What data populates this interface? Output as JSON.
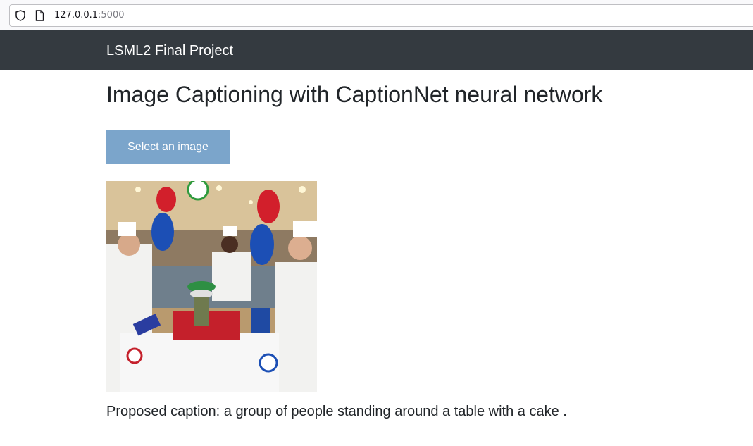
{
  "browser": {
    "url_host": "127.0.0.1",
    "url_port": ":5000",
    "icons": [
      "shield-icon",
      "page-icon"
    ]
  },
  "navbar": {
    "brand": "LSML2 Final Project",
    "background": "#343a40"
  },
  "main": {
    "title": "Image Captioning with CaptionNet neural network",
    "select_button_label": "Select an image",
    "button_color": "#7ba5cb",
    "caption_label": "Proposed caption:",
    "caption_text": "a group of people standing around a table with a cake ."
  }
}
